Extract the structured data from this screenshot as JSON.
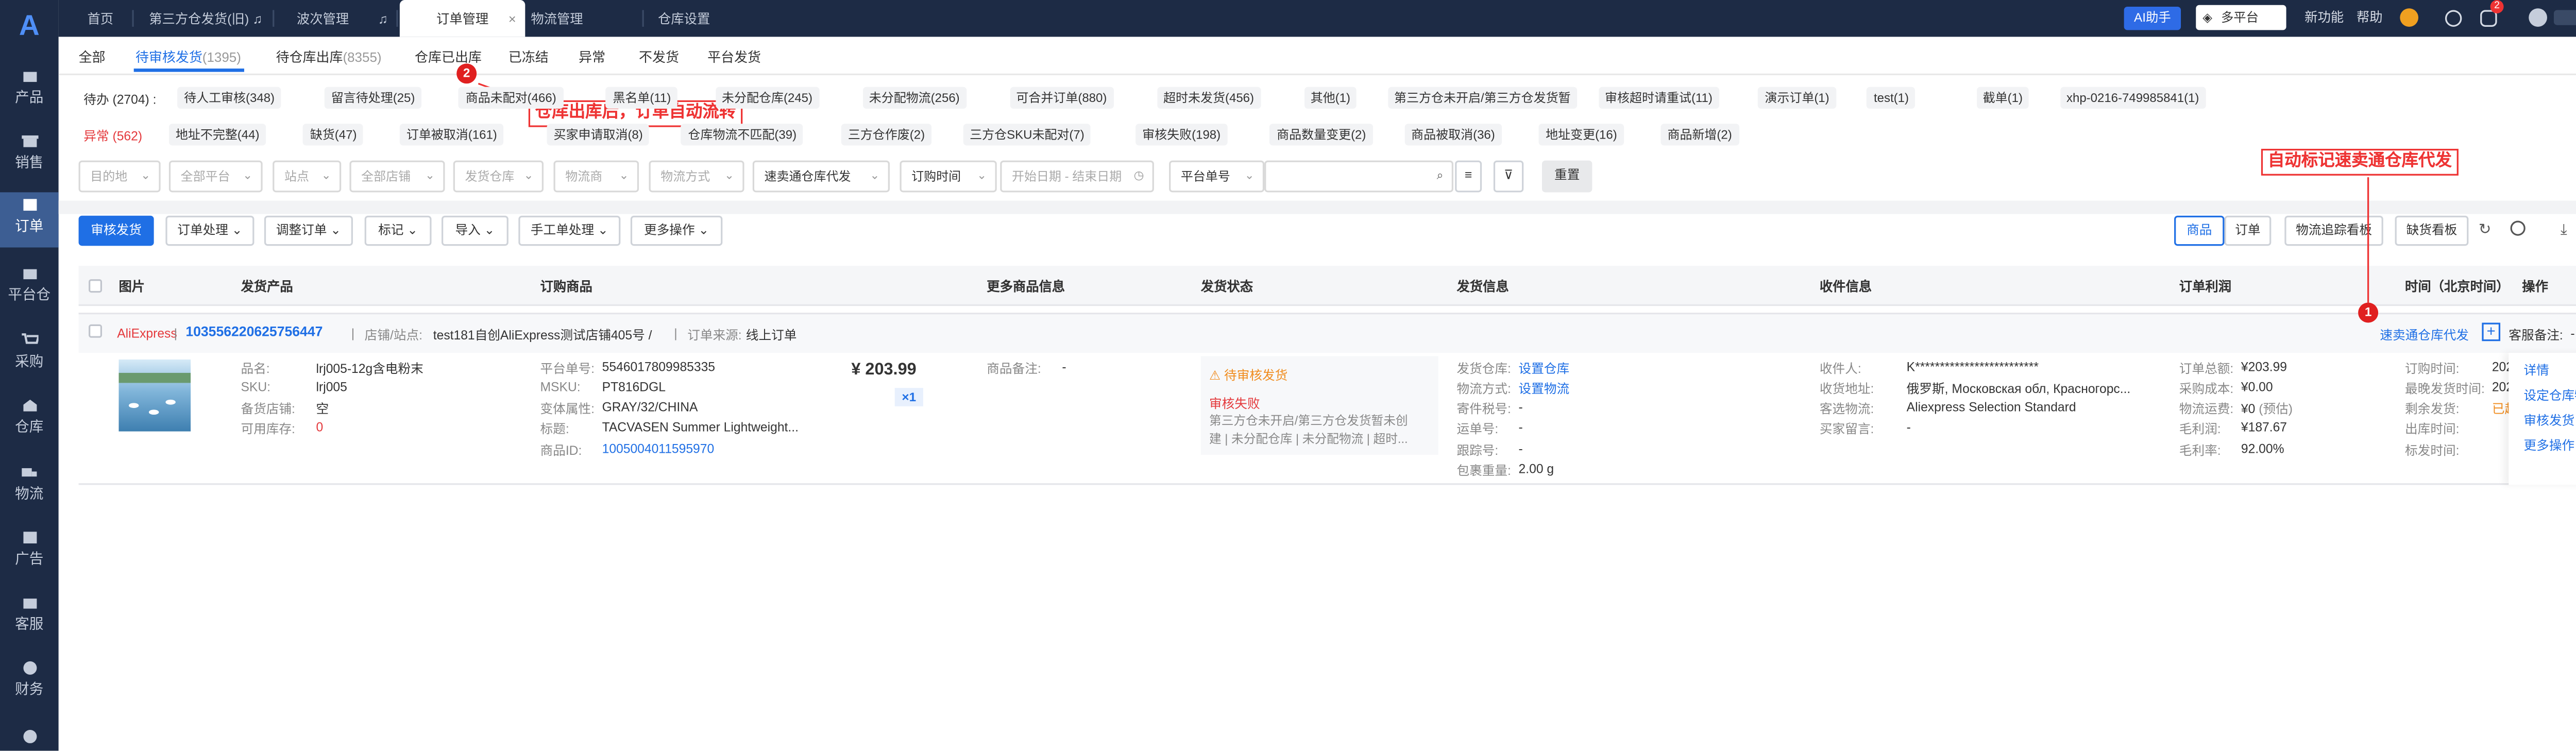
{
  "topbar": {
    "tabs": [
      "首页",
      "第三方仓发货(旧)",
      "波次管理",
      "订单管理",
      "物流管理",
      "仓库设置"
    ],
    "ai": "AI助手",
    "platform": "多平台",
    "links": [
      "新功能",
      "帮助"
    ],
    "notify_count": "2"
  },
  "sidebar": [
    "产品",
    "销售",
    "订单",
    "平台仓",
    "采购",
    "仓库",
    "物流",
    "广告",
    "客服",
    "财务"
  ],
  "status_tabs": [
    {
      "label": "全部"
    },
    {
      "label": "待审核发货",
      "count": "(1395)"
    },
    {
      "label": "待仓库出库",
      "count": "(8355)"
    },
    {
      "label": "仓库已出库"
    },
    {
      "label": "已冻结"
    },
    {
      "label": "异常"
    },
    {
      "label": "不发货"
    },
    {
      "label": "平台发货"
    }
  ],
  "pending": {
    "label": "待办",
    "count": "(2704)",
    "chips": [
      "待人工审核(348)",
      "留言待处理(25)",
      "商品未配对(466)",
      "黑名单(11)",
      "未分配仓库(245)",
      "未分配物流(256)",
      "可合并订单(880)",
      "超时未发货(456)",
      "其他(1)",
      "第三方仓未开启/第三方仓发货暂",
      "审核超时请重试(11)",
      "演示订单(1)",
      "test(1)",
      "截单(1)",
      "xhp-0216-749985841(1)"
    ]
  },
  "abnormal": {
    "label": "异常",
    "count": "(562)",
    "chips": [
      "地址不完整(44)",
      "缺货(47)",
      "订单被取消(161)",
      "买家申请取消(8)",
      "仓库物流不匹配(39)",
      "三方仓作废(2)",
      "三方仓SKU未配对(7)",
      "审核失败(198)",
      "商品数量变更(2)",
      "商品被取消(36)",
      "地址变更(16)",
      "商品新增(2)"
    ]
  },
  "filters": {
    "destination": "目的地",
    "platform": "全部平台",
    "site": "站点",
    "store": "全部店铺",
    "warehouse": "发货仓库",
    "carrier": "物流商",
    "method": "物流方式",
    "selected_wh": "速卖通仓库代发",
    "time": "订购时间",
    "date_range": "开始日期 - 结束日期",
    "order_no": "平台单号",
    "reset": "重置"
  },
  "actions": [
    "审核发货",
    "订单处理",
    "调整订单",
    "标记",
    "导入",
    "手工单处理",
    "更多操作"
  ],
  "views": {
    "product": "商品",
    "order": "订单",
    "track": "物流追踪看板",
    "oos": "缺货看板"
  },
  "columns": [
    "图片",
    "发货产品",
    "订购商品",
    "更多商品信息",
    "发货状态",
    "发货信息",
    "收件信息",
    "订单利润",
    "时间（北京时间）",
    "操作"
  ],
  "order": {
    "platform": "AliExpress",
    "id": "103556220625756447",
    "store_label": "店铺/站点:",
    "store": "test181自创AliExpress测试店铺405号 /",
    "source_label": "订单来源:",
    "source": "线上订单",
    "tag": "速卖通仓库代发",
    "remark_label": "客服备注:",
    "remark": "-",
    "product": {
      "name_l": "品名:",
      "name": "lrj005-12g含电粉末",
      "sku_l": "SKU:",
      "sku": "lrj005",
      "store_l": "备货店铺:",
      "store": "空",
      "stock_l": "可用库存:",
      "stock": "0"
    },
    "item": {
      "pno_l": "平台单号:",
      "pno": "5546017809985335",
      "msku_l": "MSKU:",
      "msku": "PT816DGL",
      "var_l": "变体属性:",
      "var": "GRAY/32/CHINA",
      "title_l": "标题:",
      "title": "TACVASEN Summer Lightweight...",
      "pid_l": "商品ID:",
      "pid": "1005004011595970",
      "price": "¥ 203.99",
      "qty": "×1"
    },
    "more": {
      "label": "商品备注:",
      "value": "-"
    },
    "status": {
      "title": "待审核发货",
      "fail": "审核失败",
      "desc1": "第三方仓未开启/第三方仓发货暂未创",
      "desc2": "建 | 未分配仓库 | 未分配物流 | 超时..."
    },
    "ship": {
      "wh_l": "发货仓库:",
      "wh": "设置仓库",
      "lg_l": "物流方式:",
      "lg": "设置物流",
      "tax_l": "寄件税号:",
      "tax": "-",
      "trk_l": "运单号:",
      "trk": "-",
      "fol_l": "跟踪号:",
      "fol": "-",
      "wt_l": "包裹重量:",
      "wt": "2.00 g"
    },
    "recv": {
      "name_l": "收件人:",
      "name": "K*************************",
      "addr_l": "收货地址:",
      "addr": "俄罗斯, Московская обл, Красногорс...",
      "lg_l": "客选物流:",
      "lg": "Aliexpress Selection Standard",
      "msg_l": "买家留言:",
      "msg": "-"
    },
    "profit": {
      "total_l": "订单总额:",
      "total": "¥203.99",
      "cost_l": "采购成本:",
      "cost": "¥0.00",
      "freight_l": "物流运费:",
      "freight": "¥0",
      "est": "(预估)",
      "gross_l": "毛利润:",
      "gross": "¥187.67",
      "rate_l": "毛利率:",
      "rate": "92.00%"
    },
    "time": {
      "order_l": "订购时间:",
      "order": "202",
      "late_l": "最晚发货时间:",
      "late": "202",
      "remain_l": "剩余发货:",
      "remain": "已超",
      "out_l": "出库时间:",
      "mark_l": "标发时间:"
    },
    "ops": [
      "详情",
      "设定仓库物流",
      "审核发货",
      "更多操作"
    ]
  },
  "annotations": {
    "a1": "自动标记速卖通仓库代发",
    "a2": "仓库出库后，订单自动流转",
    "n1": "1",
    "n2": "2"
  }
}
